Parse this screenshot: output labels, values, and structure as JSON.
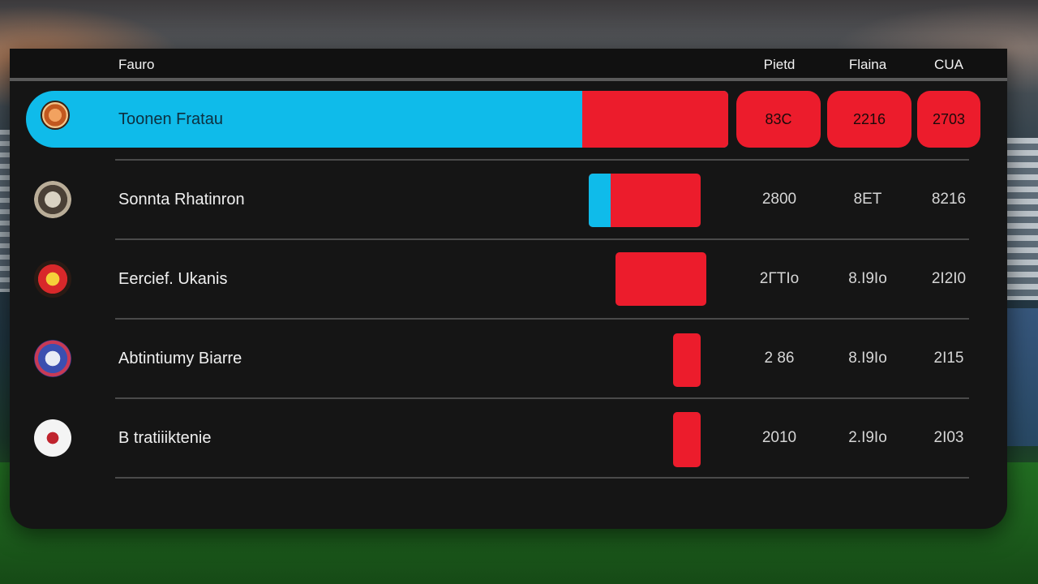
{
  "header": {
    "col_team": "Fauro",
    "col_1": "Pietd",
    "col_2": "Flaina",
    "col_3": "CUA"
  },
  "rows": [
    {
      "name": "Toonen Fratau",
      "logo_icon": "club-crest-orange-icon",
      "stat_1": "83C",
      "stat_2": "2216",
      "stat_3": "2703",
      "highlighted": true
    },
    {
      "name": "Sonnta Rhatinron",
      "logo_icon": "club-crest-grey-icon",
      "stat_1": "2800",
      "stat_2": "8ET",
      "stat_3": "8216",
      "bar": {
        "segments": [
          "blue",
          "red"
        ]
      }
    },
    {
      "name": "Eercief. Ukanis",
      "logo_icon": "club-crest-red-yellow-icon",
      "stat_1": "2ΓΤΙο",
      "stat_2": "8.Ι9Ιο",
      "stat_3": "2Ι2Ι0",
      "bar": {
        "segments": [
          "red"
        ]
      }
    },
    {
      "name": "Abtintiumy Biarre",
      "logo_icon": "club-crest-blue-icon",
      "stat_1": "2 86",
      "stat_2": "8.Ι9Ιο",
      "stat_3": "2Ι15",
      "bar": {
        "segments": [
          "red"
        ]
      }
    },
    {
      "name": "B tratiiiktenie",
      "logo_icon": "club-crest-white-red-icon",
      "stat_1": "2010",
      "stat_2": "2.Ι9Ιο",
      "stat_3": "2Ι03",
      "bar": {
        "segments": [
          "red"
        ]
      }
    }
  ],
  "colors": {
    "accent_blue": "#0fbbea",
    "accent_red": "#ec1c2c",
    "panel_bg": "#151515"
  }
}
